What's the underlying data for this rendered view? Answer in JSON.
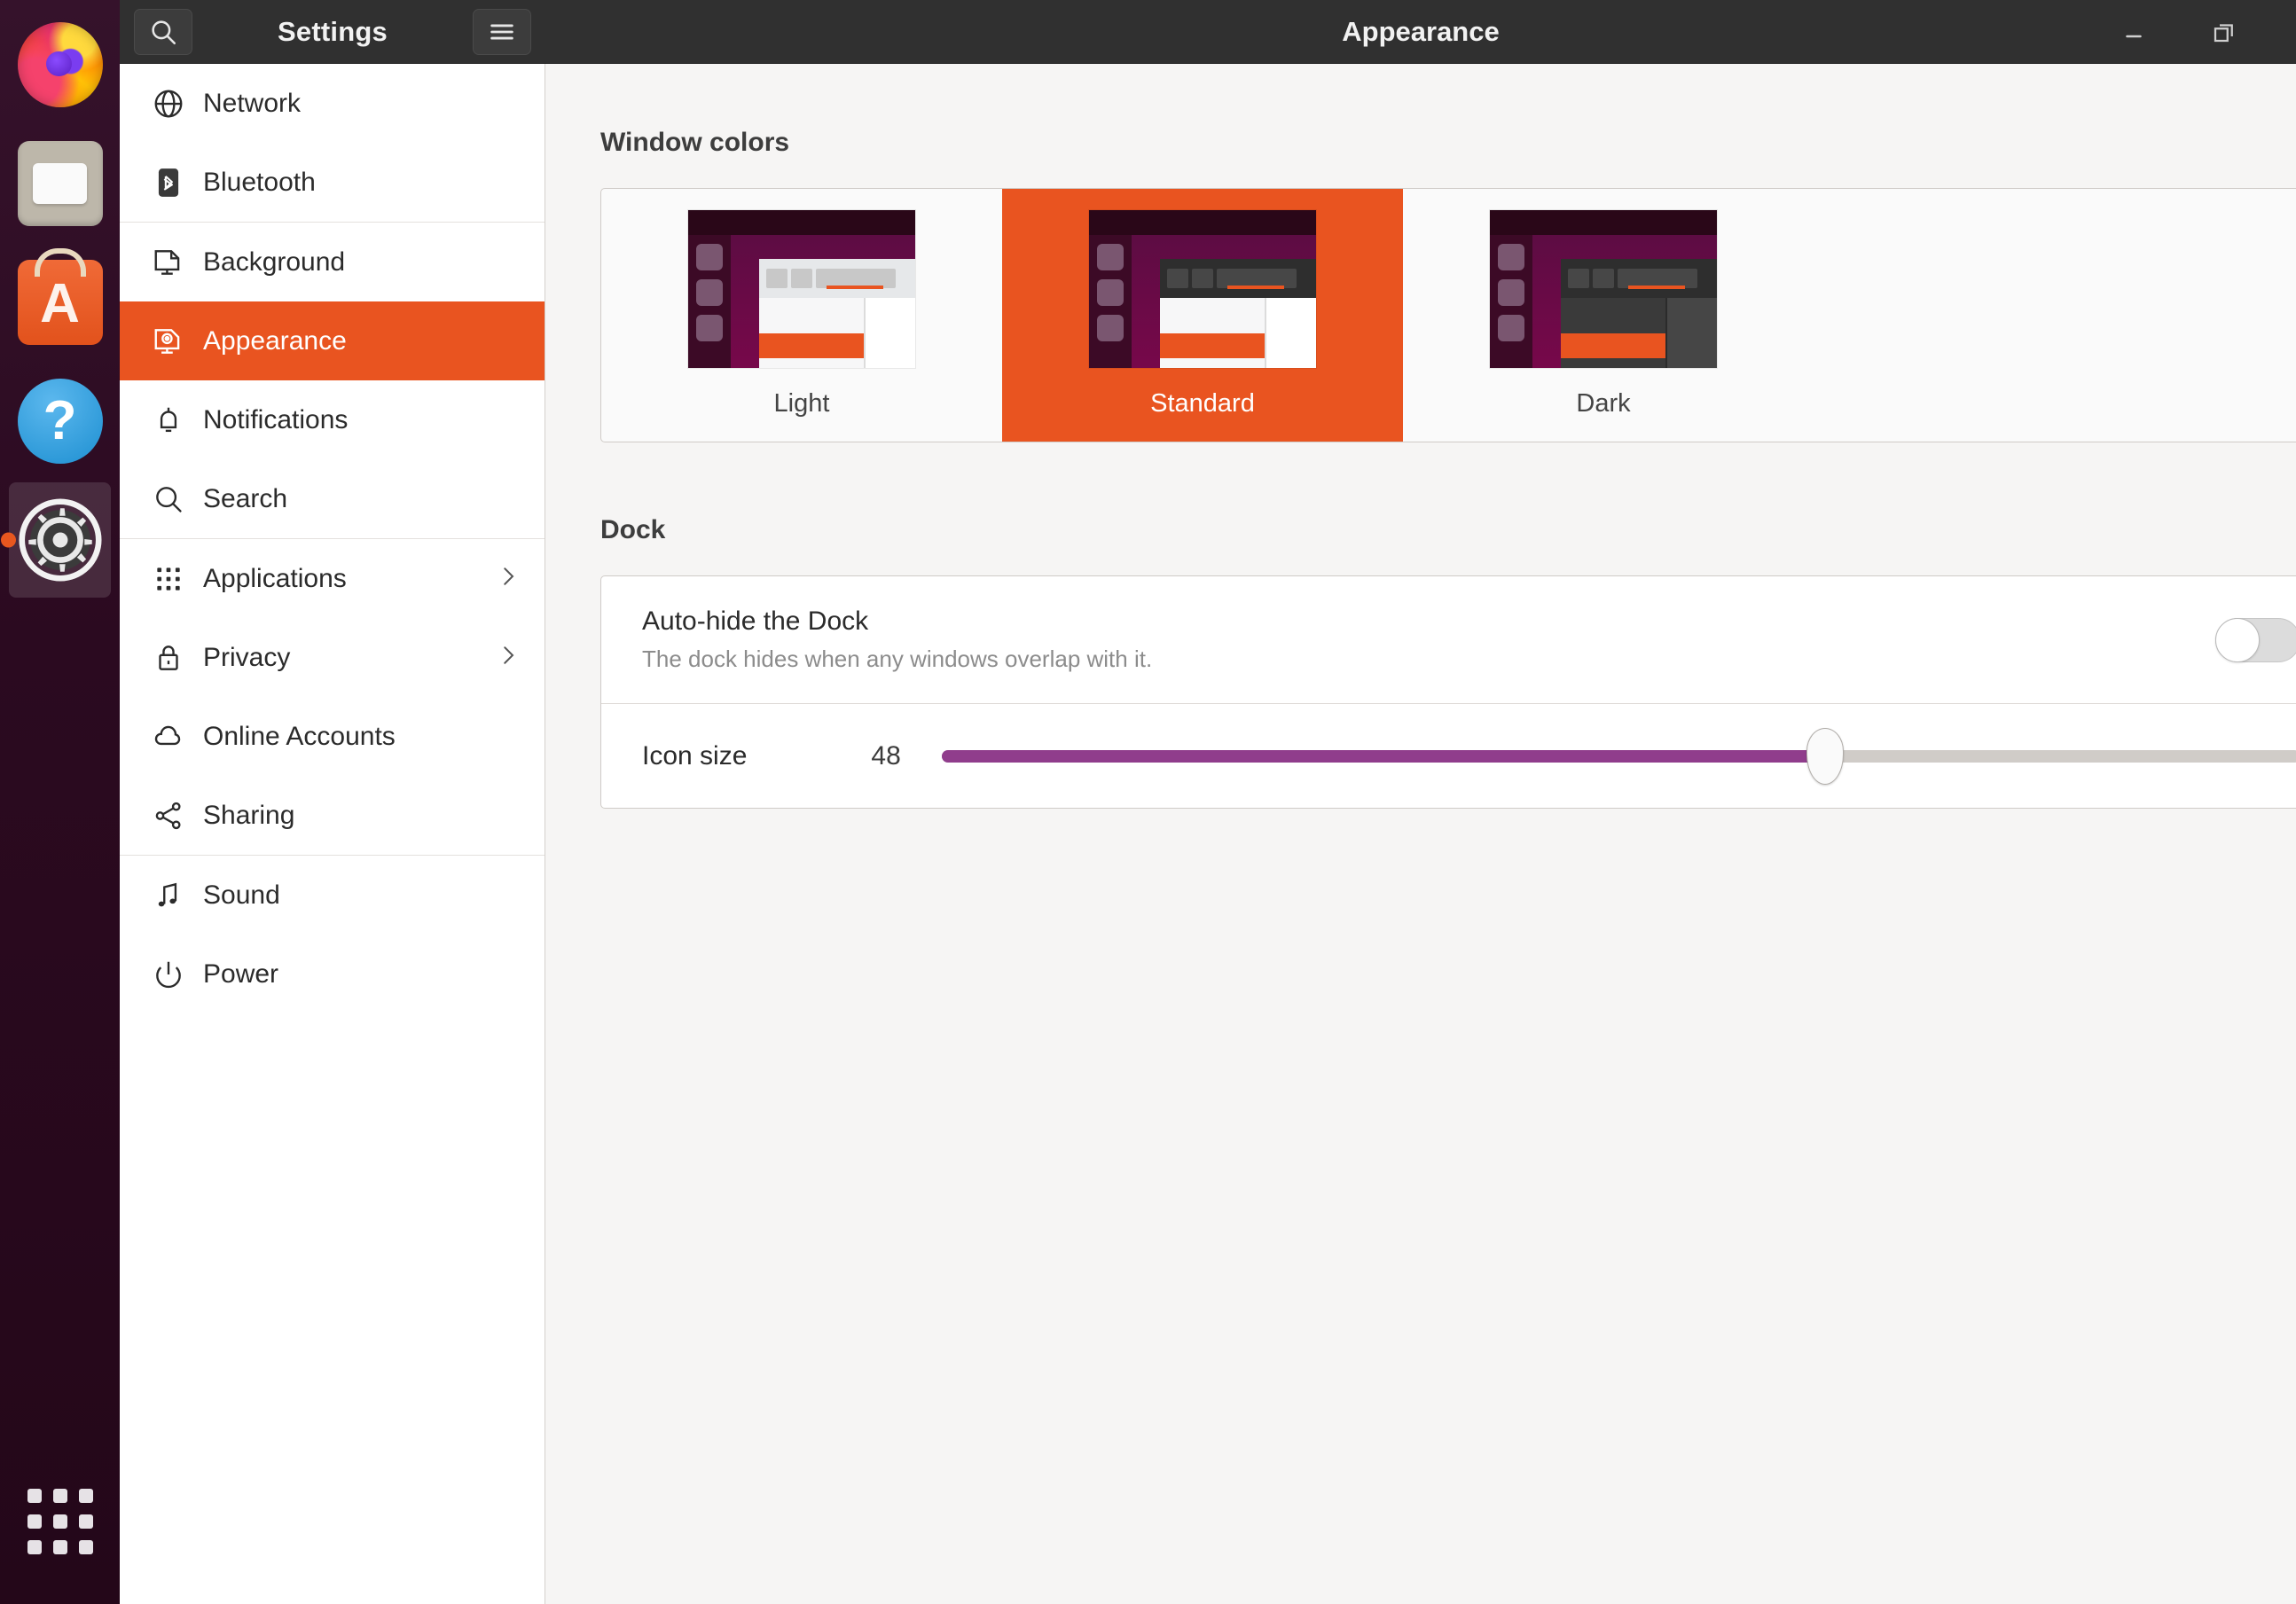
{
  "dock": {
    "items": [
      {
        "name": "firefox",
        "label": "Firefox",
        "running": false
      },
      {
        "name": "files",
        "label": "Files",
        "running": false
      },
      {
        "name": "software",
        "label": "Ubuntu Software",
        "glyph": "A",
        "running": false
      },
      {
        "name": "help",
        "label": "Help",
        "glyph": "?",
        "running": false
      },
      {
        "name": "settings",
        "label": "Settings",
        "running": true
      }
    ],
    "show_apps_label": "Show Applications"
  },
  "titlebar": {
    "search_icon": "search-icon",
    "sidebar_title": "Settings",
    "menu_icon": "hamburger-menu-icon",
    "page_title": "Appearance",
    "minimize_label": "Minimize",
    "restore_label": "Restore"
  },
  "sidebar": {
    "items": [
      {
        "label": "Network",
        "icon": "globe-icon",
        "chevron": false,
        "selected": false
      },
      {
        "label": "Bluetooth",
        "icon": "bluetooth-icon",
        "chevron": false,
        "selected": false
      },
      {
        "label": "Background",
        "icon": "monitor-icon",
        "chevron": false,
        "selected": false,
        "group_start": true
      },
      {
        "label": "Appearance",
        "icon": "appearance-icon",
        "chevron": false,
        "selected": true
      },
      {
        "label": "Notifications",
        "icon": "bell-icon",
        "chevron": false,
        "selected": false
      },
      {
        "label": "Search",
        "icon": "search-icon",
        "chevron": false,
        "selected": false
      },
      {
        "label": "Applications",
        "icon": "grid-icon",
        "chevron": true,
        "selected": false,
        "group_start": true
      },
      {
        "label": "Privacy",
        "icon": "lock-icon",
        "chevron": true,
        "selected": false
      },
      {
        "label": "Online Accounts",
        "icon": "cloud-icon",
        "chevron": false,
        "selected": false
      },
      {
        "label": "Sharing",
        "icon": "share-icon",
        "chevron": false,
        "selected": false
      },
      {
        "label": "Sound",
        "icon": "music-note-icon",
        "chevron": false,
        "selected": false,
        "group_start": true
      },
      {
        "label": "Power",
        "icon": "power-icon",
        "chevron": false,
        "selected": false
      }
    ]
  },
  "content": {
    "window_colors": {
      "title": "Window colors",
      "themes": [
        {
          "label": "Light",
          "selected": false,
          "variant": "light"
        },
        {
          "label": "Standard",
          "selected": true,
          "variant": "standard"
        },
        {
          "label": "Dark",
          "selected": false,
          "variant": "dark"
        }
      ]
    },
    "dock": {
      "title": "Dock",
      "autohide": {
        "title": "Auto-hide the Dock",
        "subtitle": "The dock hides when any windows overlap with it.",
        "value": "off"
      },
      "icon_size": {
        "title": "Icon size",
        "value": "48",
        "percent": 65
      }
    }
  },
  "colors": {
    "accent": "#e95420",
    "slider_fill": "#903d8c",
    "titlebar": "#303030",
    "sidebar_bg": "#ffffff",
    "content_bg": "#f6f5f4",
    "dock_bg": "#2c001e"
  }
}
